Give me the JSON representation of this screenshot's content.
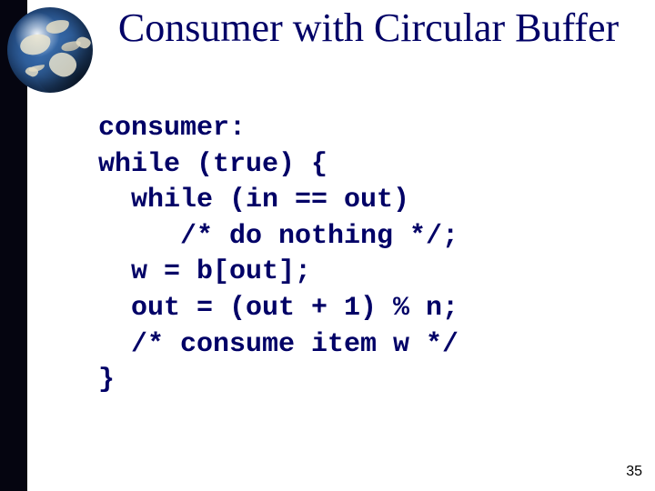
{
  "title": "Consumer with Circular Buffer",
  "code_lines": [
    "consumer:",
    "while (true) {",
    "  while (in == out)",
    "     /* do nothing */;",
    "  w = b[out];",
    "  out = (out + 1) % n;",
    "  /* consume item w */",
    "}"
  ],
  "page_number": "35"
}
